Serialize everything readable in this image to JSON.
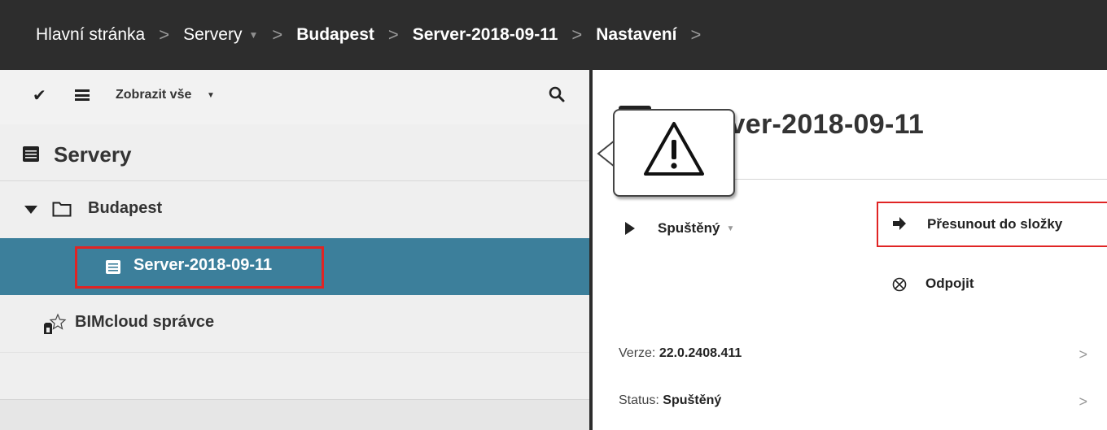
{
  "breadcrumb": {
    "items": [
      {
        "label": "Hlavní stránka"
      },
      {
        "label": "Servery"
      },
      {
        "label": "Budapest"
      },
      {
        "label": "Server-2018-09-11"
      },
      {
        "label": "Nastavení"
      }
    ],
    "separator": ">"
  },
  "left": {
    "toolbar": {
      "filter_label": "Zobrazit vše"
    },
    "header_title": "Servery",
    "tree": {
      "folder_label": "Budapest",
      "server_label": "Server-2018-09-11",
      "bimcloud_label": "BIMcloud správce"
    },
    "selected_color": "#3c7f9b",
    "highlight_color": "#e02424"
  },
  "right": {
    "title": "rver-2018-09-11",
    "status_action": "Spuštěný",
    "move_action": "Přesunout do složky",
    "disconnect_action": "Odpojit",
    "info": {
      "version_label": "Verze:",
      "version_value": "22.0.2408.411",
      "status_label": "Status:",
      "status_value": "Spuštěný"
    }
  },
  "callout": {
    "icon": "warning-icon"
  }
}
